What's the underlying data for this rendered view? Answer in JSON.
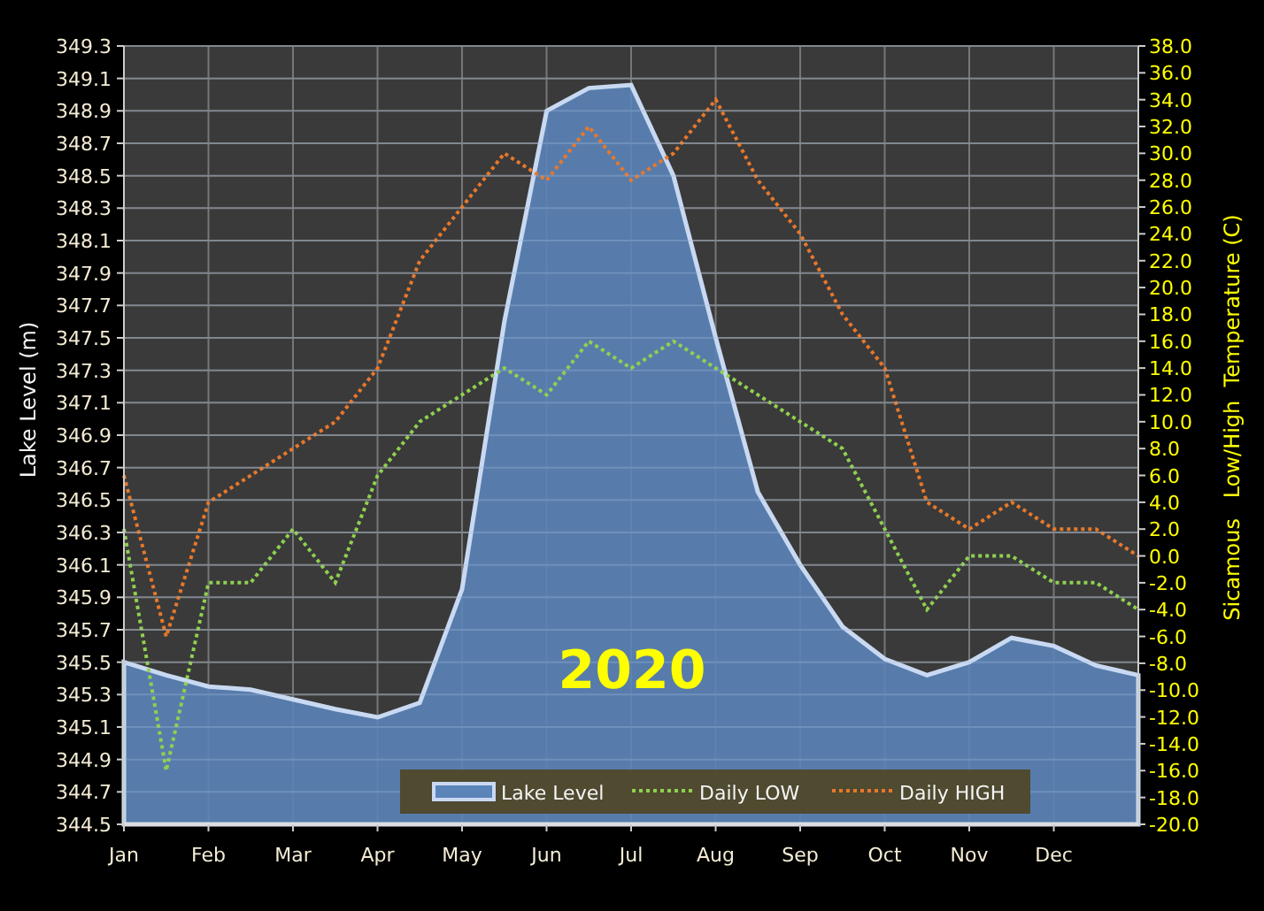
{
  "chart_data": {
    "type": "line",
    "ylabel": "Lake Level (m)",
    "y2label": "Sicamous   Low/High  Temperature (C)",
    "grid": true,
    "legend": true,
    "ylim": [
      344.5,
      349.3
    ],
    "y2lim": [
      -20,
      38
    ],
    "categories": [
      "Jan",
      null,
      "Feb",
      null,
      "Mar",
      null,
      "Apr",
      null,
      "May",
      null,
      "Jun",
      null,
      "Jul",
      null,
      "Aug",
      null,
      "Sep",
      null,
      "Oct",
      null,
      "Nov",
      null,
      "Dec",
      null,
      null
    ],
    "yticks": [
      344.5,
      344.7,
      344.9,
      345.1,
      345.3,
      345.5,
      345.7,
      345.9,
      346.1,
      346.3,
      346.5,
      346.7,
      346.9,
      347.1,
      347.3,
      347.5,
      347.7,
      347.9,
      348.1,
      348.3,
      348.5,
      348.7,
      348.9,
      349.1,
      349.3
    ],
    "y2ticks": [
      {
        "value": -20,
        "label": "-20.0"
      },
      {
        "value": -18,
        "label": "-18.0"
      },
      {
        "value": -16,
        "label": "-16.0"
      },
      {
        "value": -14,
        "label": "-14.0"
      },
      {
        "value": -12,
        "label": "-12.0"
      },
      {
        "value": -10,
        "label": "-10.0"
      },
      {
        "value": -8,
        "label": "-8.0"
      },
      {
        "value": -6,
        "label": "-6.0"
      },
      {
        "value": -4,
        "label": "-4.0"
      },
      {
        "value": -2,
        "label": "-2.0"
      },
      {
        "value": 0,
        "label": "0.0"
      },
      {
        "value": 2,
        "label": "2.0"
      },
      {
        "value": 4,
        "label": "4.0"
      },
      {
        "value": 6,
        "label": "6.0"
      },
      {
        "value": 8,
        "label": "8.0"
      },
      {
        "value": 10,
        "label": "10.0"
      },
      {
        "value": 12,
        "label": "12.0"
      },
      {
        "value": 14,
        "label": "14.0"
      },
      {
        "value": 16,
        "label": "16.0"
      },
      {
        "value": 18,
        "label": "18.0"
      },
      {
        "value": 20,
        "label": "20.0"
      },
      {
        "value": 22,
        "label": "22.0"
      },
      {
        "value": 24,
        "label": "24.0"
      },
      {
        "value": 26,
        "label": "26.0"
      },
      {
        "value": 28,
        "label": "28.0"
      },
      {
        "value": 30,
        "label": "30.0"
      },
      {
        "value": 32,
        "label": "32.0"
      },
      {
        "value": 34,
        "label": "34.0"
      },
      {
        "value": 36,
        "label": "36.0"
      },
      {
        "value": 38,
        "label": "38.0"
      }
    ],
    "series": [
      {
        "name": "Lake Level",
        "type": "area",
        "color": "#5b84b8",
        "values": [
          345.5,
          345.42,
          345.35,
          345.33,
          345.27,
          345.21,
          345.16,
          345.25,
          345.95,
          347.6,
          348.9,
          349.04,
          349.06,
          348.5,
          347.5,
          346.55,
          346.1,
          345.72,
          345.52,
          345.42,
          345.5,
          345.65,
          345.6,
          345.48,
          345.42
        ]
      },
      {
        "name": "Daily LOW",
        "type": "line",
        "axis": "y2",
        "line_style": "dotted",
        "color": "#8fd14f",
        "values": [
          2,
          -16,
          -2,
          -2,
          2,
          -2,
          6,
          10,
          12,
          14,
          12,
          16,
          14,
          16,
          14,
          12,
          10,
          8,
          2,
          -4,
          0,
          0,
          -2,
          -2,
          -4
        ]
      },
      {
        "name": "Daily HIGH",
        "type": "line",
        "axis": "y2",
        "line_style": "dotted",
        "color": "#e8782a",
        "values": [
          6,
          -6,
          4,
          6,
          8,
          10,
          14,
          22,
          26,
          30,
          28,
          32,
          28,
          30,
          34,
          28,
          24,
          18,
          14,
          4,
          2,
          4,
          2,
          2,
          0
        ]
      }
    ],
    "annotations": [
      {
        "text": "2020"
      }
    ]
  }
}
